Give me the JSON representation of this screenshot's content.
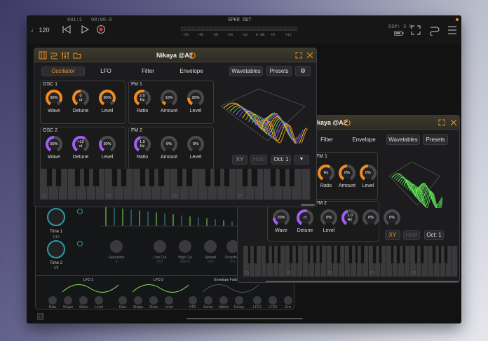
{
  "colors": {
    "accent": "#f28a22",
    "purple": "#a35df3",
    "bg": "#121212",
    "record": "#d33"
  },
  "topbar": {
    "tempo": "♩ 120",
    "position": "001:1",
    "time": "00:00.0",
    "meter_label": "SPKR OUT",
    "meter_ticks": [
      "-60",
      "-48",
      "-36",
      "-24",
      "-12",
      "0 dB",
      "+6",
      "+12"
    ],
    "dsp": "DSP: 3 %",
    "icons": [
      "rewind-icon",
      "play-icon",
      "record-icon",
      "battery-icon",
      "fullscreen-icon",
      "routing-icon",
      "menu-icon"
    ]
  },
  "front": {
    "title": "Nikaya @A1",
    "header_icons": [
      "keys-icon",
      "routing-icon",
      "mixer-sliders-icon",
      "folder-icon",
      "power-icon",
      "expand-icon",
      "close-icon"
    ],
    "tabs": [
      "Oscillator",
      "LFO",
      "Filter",
      "Envelope"
    ],
    "active_tab": "Oscillator",
    "wavetables": "Wavetables",
    "presets": "Presets",
    "osc1": {
      "title": "OSC 1",
      "knobs": [
        {
          "v": "90%",
          "l": "Wave",
          "c": "orange",
          "f": 0.9
        },
        {
          "v": "0\nct",
          "l": "Detune",
          "c": "orange",
          "f": 0.5
        },
        {
          "v": "90%",
          "l": "Level",
          "c": "orange",
          "f": 0.9
        }
      ]
    },
    "fm1": {
      "title": "FM 1",
      "knobs": [
        {
          "v": "2.0\nHz",
          "l": "Ratio",
          "c": "orange",
          "f": 0.55
        },
        {
          "v": "10%",
          "l": "Amount",
          "c": "orange",
          "f": 0.1
        },
        {
          "v": "20%",
          "l": "Level",
          "c": "orange",
          "f": 0.2
        }
      ]
    },
    "osc2": {
      "title": "OSC 2",
      "knobs": [
        {
          "v": "50%",
          "l": "Wave",
          "c": "purple",
          "f": 0.5
        },
        {
          "v": "+12\nct",
          "l": "Detune",
          "c": "purple",
          "f": 0.62
        },
        {
          "v": "30%",
          "l": "Level",
          "c": "purple",
          "f": 0.3
        }
      ]
    },
    "fm2": {
      "title": "FM 2",
      "knobs": [
        {
          "v": "1.0\nHz",
          "l": "Ratio",
          "c": "purple",
          "f": 0.45
        },
        {
          "v": "0%",
          "l": "Amount",
          "c": "purple",
          "f": 0
        },
        {
          "v": "0%",
          "l": "Level",
          "c": "purple",
          "f": 0
        }
      ]
    },
    "xy": "XY",
    "hold": "Hold",
    "oct": "Oct: 1",
    "octaves": [
      "C1",
      "C2",
      "C3",
      "C4"
    ]
  },
  "back": {
    "title": "Nikaya @A2",
    "tabs": [
      "Filter",
      "Envelope"
    ],
    "wavetables": "Wavetables",
    "presets": "Presets",
    "fm1": {
      "title": "FM 1",
      "labels": [
        "Ratio",
        "Amount",
        "Level"
      ],
      "values": [
        "Hz",
        "0%",
        "0%"
      ]
    },
    "fm2": {
      "title": "FM 2",
      "values": [
        "1.0\nHz",
        "0%",
        "0%"
      ]
    },
    "row_labels": [
      "Wave",
      "Detune",
      "Level"
    ],
    "row_values": [
      "20%",
      "ct",
      "0%"
    ],
    "xy": "XY",
    "hold": "Hold",
    "oct": "Oct: 1",
    "octaves": [
      "C1",
      "C2",
      "C3",
      "C4",
      "C5"
    ]
  },
  "fx": {
    "time1": "Time 1",
    "time1_val": "1/16",
    "time2": "Time 2",
    "time2_val": "1/8",
    "knobs": [
      {
        "l": "Saturation",
        "v": "0"
      },
      {
        "l": "Low Cut",
        "v": "0Hz"
      },
      {
        "l": "High Cut",
        "v": "20kHz"
      },
      {
        "l": "Spread",
        "v": "Text"
      },
      {
        "l": "Crossfeed",
        "v": "0%"
      }
    ],
    "lfo1": "LFO 1",
    "lfo2": "LFO 2",
    "env": "Envelope Follower",
    "lfo1_knobs": [
      "Rate",
      "Shape",
      "Skew",
      "Level"
    ],
    "lfo2_knobs": [
      "Rate",
      "Shape",
      "Skew",
      "Level"
    ],
    "env_knobs": [
      "HPF",
      "Sense",
      "Attack",
      "Decay"
    ],
    "extra_knobs": [
      "LFO1",
      "LFO2",
      "Env"
    ]
  }
}
